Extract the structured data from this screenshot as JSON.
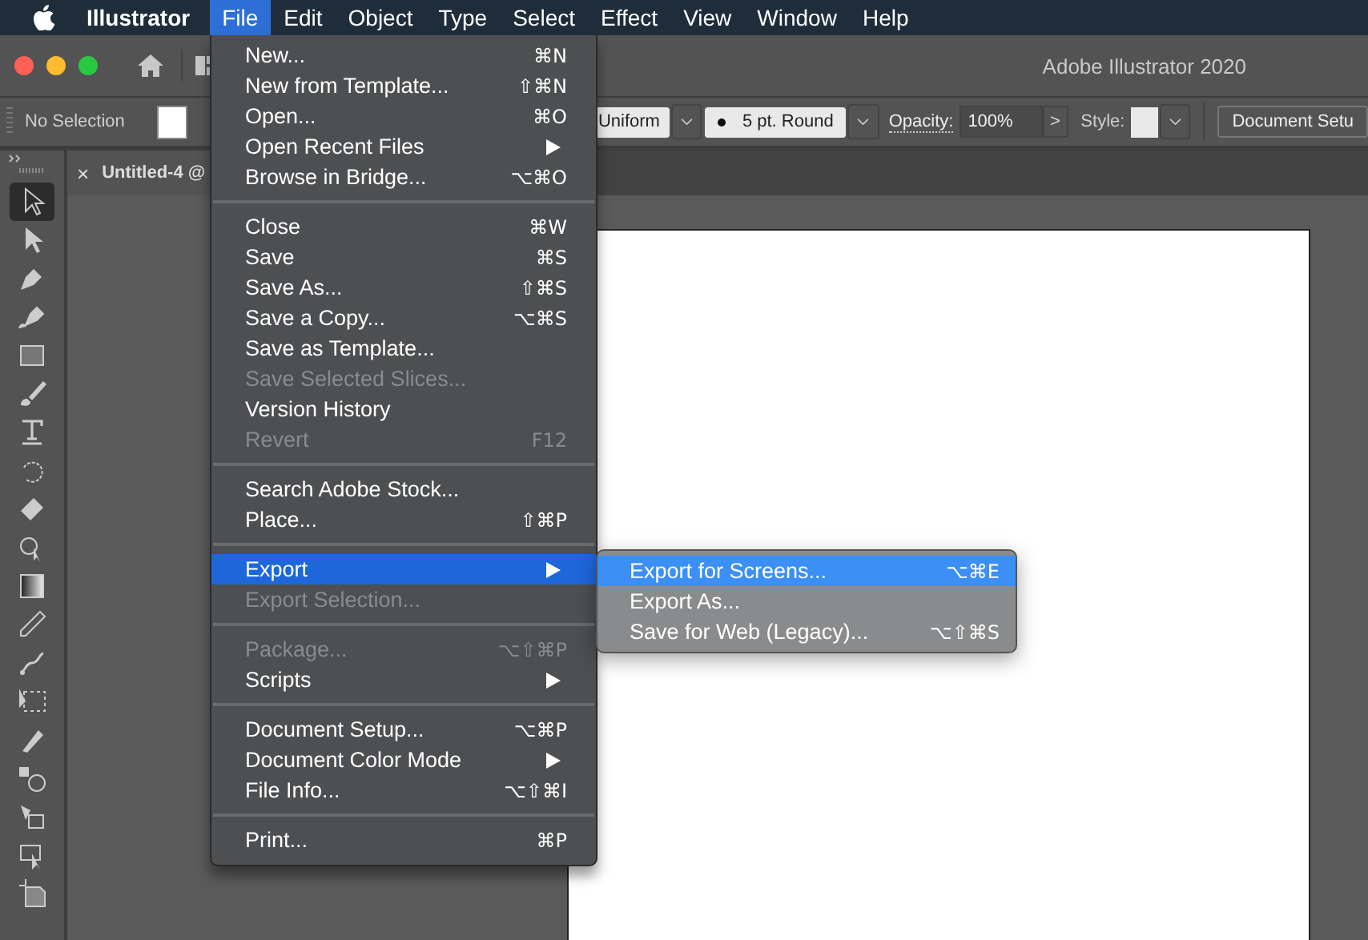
{
  "menubar": {
    "app_name": "Illustrator",
    "menus": [
      {
        "label": "File",
        "selected": true
      },
      {
        "label": "Edit",
        "selected": false
      },
      {
        "label": "Object",
        "selected": false
      },
      {
        "label": "Type",
        "selected": false
      },
      {
        "label": "Select",
        "selected": false
      },
      {
        "label": "Effect",
        "selected": false
      },
      {
        "label": "View",
        "selected": false
      },
      {
        "label": "Window",
        "selected": false
      },
      {
        "label": "Help",
        "selected": false
      }
    ]
  },
  "window": {
    "title": "Adobe Illustrator 2020"
  },
  "control_bar": {
    "selection": "No Selection",
    "stroke_profile": "Uniform",
    "brush": "5 pt. Round",
    "opacity_label": "Opacity:",
    "opacity": "100%",
    "opacity_arrow": ">",
    "style_label": "Style:",
    "document_setup": "Document Setu"
  },
  "document_tab": {
    "close": "×",
    "title": "Untitled-4 @"
  },
  "tools": [
    {
      "kind": "selection",
      "selected": true
    },
    {
      "kind": "direct",
      "selected": false
    },
    {
      "kind": "pen",
      "selected": false
    },
    {
      "kind": "curvature",
      "selected": false
    },
    {
      "kind": "rectangle",
      "selected": false
    },
    {
      "kind": "brush",
      "selected": false
    },
    {
      "kind": "type",
      "selected": false
    },
    {
      "kind": "rotate",
      "selected": false
    },
    {
      "kind": "eraser",
      "selected": false
    },
    {
      "kind": "shape-builder",
      "selected": false
    },
    {
      "kind": "gradient",
      "selected": false
    },
    {
      "kind": "eyedropper",
      "selected": false
    },
    {
      "kind": "puppet",
      "selected": false
    },
    {
      "kind": "artboard",
      "selected": false
    },
    {
      "kind": "blob",
      "selected": false
    },
    {
      "kind": "blend",
      "selected": false
    },
    {
      "kind": "live-paint",
      "selected": false
    },
    {
      "kind": "perspective",
      "selected": false
    },
    {
      "kind": "crop",
      "selected": false
    }
  ],
  "file_menu": [
    {
      "kind": "item",
      "label": "New...",
      "shortcut": "⌘N",
      "disabled": false,
      "submenu": false,
      "selected": false
    },
    {
      "kind": "item",
      "label": "New from Template...",
      "shortcut": "⇧⌘N",
      "disabled": false,
      "submenu": false,
      "selected": false
    },
    {
      "kind": "item",
      "label": "Open...",
      "shortcut": "⌘O",
      "disabled": false,
      "submenu": false,
      "selected": false
    },
    {
      "kind": "item",
      "label": "Open Recent Files",
      "disabled": false,
      "submenu": true,
      "selected": false
    },
    {
      "kind": "item",
      "label": "Browse in Bridge...",
      "shortcut": "⌥⌘O",
      "disabled": false,
      "submenu": false,
      "selected": false
    },
    {
      "kind": "separator"
    },
    {
      "kind": "item",
      "label": "Close",
      "shortcut": "⌘W",
      "disabled": false,
      "submenu": false,
      "selected": false
    },
    {
      "kind": "item",
      "label": "Save",
      "shortcut": "⌘S",
      "disabled": false,
      "submenu": false,
      "selected": false
    },
    {
      "kind": "item",
      "label": "Save As...",
      "shortcut": "⇧⌘S",
      "disabled": false,
      "submenu": false,
      "selected": false
    },
    {
      "kind": "item",
      "label": "Save a Copy...",
      "shortcut": "⌥⌘S",
      "disabled": false,
      "submenu": false,
      "selected": false
    },
    {
      "kind": "item",
      "label": "Save as Template...",
      "disabled": false,
      "submenu": false,
      "selected": false
    },
    {
      "kind": "item",
      "label": "Save Selected Slices...",
      "disabled": true,
      "submenu": false,
      "selected": false
    },
    {
      "kind": "item",
      "label": "Version History",
      "disabled": false,
      "submenu": false,
      "selected": false
    },
    {
      "kind": "item",
      "label": "Revert",
      "shortcut": "F12",
      "disabled": true,
      "submenu": false,
      "selected": false
    },
    {
      "kind": "separator"
    },
    {
      "kind": "item",
      "label": "Search Adobe Stock...",
      "disabled": false,
      "submenu": false,
      "selected": false
    },
    {
      "kind": "item",
      "label": "Place...",
      "shortcut": "⇧⌘P",
      "disabled": false,
      "submenu": false,
      "selected": false
    },
    {
      "kind": "separator"
    },
    {
      "kind": "item",
      "label": "Export",
      "disabled": false,
      "submenu": true,
      "selected": true
    },
    {
      "kind": "item",
      "label": "Export Selection...",
      "disabled": true,
      "submenu": false,
      "selected": false
    },
    {
      "kind": "separator"
    },
    {
      "kind": "item",
      "label": "Package...",
      "shortcut": "⌥⇧⌘P",
      "disabled": true,
      "submenu": false,
      "selected": false
    },
    {
      "kind": "item",
      "label": "Scripts",
      "disabled": false,
      "submenu": true,
      "selected": false
    },
    {
      "kind": "separator"
    },
    {
      "kind": "item",
      "label": "Document Setup...",
      "shortcut": "⌥⌘P",
      "disabled": false,
      "submenu": false,
      "selected": false
    },
    {
      "kind": "item",
      "label": "Document Color Mode",
      "disabled": false,
      "submenu": true,
      "selected": false
    },
    {
      "kind": "item",
      "label": "File Info...",
      "shortcut": "⌥⇧⌘I",
      "disabled": false,
      "submenu": false,
      "selected": false
    },
    {
      "kind": "separator"
    },
    {
      "kind": "item",
      "label": "Print...",
      "shortcut": "⌘P",
      "disabled": false,
      "submenu": false,
      "selected": false
    }
  ],
  "export_submenu": [
    {
      "label": "Export for Screens...",
      "shortcut": "⌥⌘E",
      "selected": true
    },
    {
      "label": "Export As...",
      "selected": false
    },
    {
      "label": "Save for Web (Legacy)...",
      "shortcut": "⌥⇧⌘S",
      "selected": false
    }
  ]
}
